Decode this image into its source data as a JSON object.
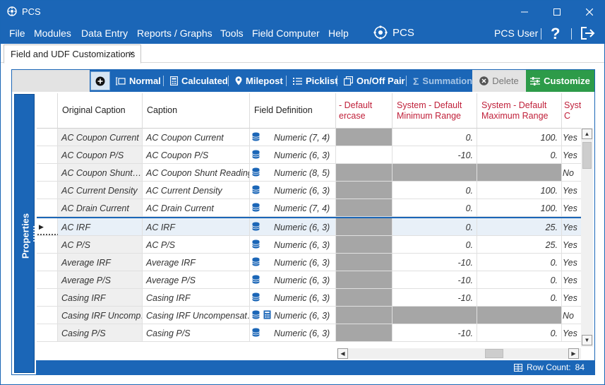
{
  "window": {
    "title": "PCS"
  },
  "menu": {
    "items": [
      "File",
      "Modules",
      "Data Entry",
      "Reports / Graphs",
      "Tools",
      "Field Computer",
      "Help"
    ],
    "brand": "PCS",
    "user": "PCS User",
    "help": "?"
  },
  "tab": {
    "label": "Field and UDF Customizations",
    "close": "×"
  },
  "toolbar": {
    "normal": "Normal",
    "calculated": "Calculated",
    "milepost": "Milepost",
    "picklist": "Picklist",
    "onoff": "On/Off Pair",
    "summation": "Summation",
    "delete": "Delete",
    "customize": "Customize"
  },
  "properties_label": "Properties",
  "grid": {
    "headers": {
      "original": "Original Caption",
      "caption": "Caption",
      "definition": "Field Definition",
      "default_pct": "- Default ercase",
      "min_range": "System - Default Minimum Range",
      "max_range": "System - Default Maximum Range",
      "sys_c": "Syste C"
    },
    "rows": [
      {
        "orig": "AC Coupon Current",
        "caption": "AC Coupon Current",
        "def": "Numeric (7, 4)",
        "calc": false,
        "pct_gray": true,
        "min": "0.",
        "max": "100.",
        "yn": "Yes"
      },
      {
        "orig": "AC Coupon P/S",
        "caption": "AC Coupon P/S",
        "def": "Numeric (6, 3)",
        "calc": false,
        "pct_gray": false,
        "min": "-10.",
        "max": "0.",
        "yn": "Yes"
      },
      {
        "orig": "AC Coupon Shunt…",
        "caption": "AC Coupon Shunt Reading",
        "def": "Numeric (8, 5)",
        "calc": false,
        "pct_gray": true,
        "min": "",
        "max": "",
        "yn": "No",
        "range_gray": true
      },
      {
        "orig": "AC Current Density",
        "caption": "AC Current Density",
        "def": "Numeric (6, 3)",
        "calc": false,
        "pct_gray": true,
        "min": "0.",
        "max": "100.",
        "yn": "Yes"
      },
      {
        "orig": "AC Drain Current",
        "caption": "AC Drain Current",
        "def": "Numeric (7, 4)",
        "calc": false,
        "pct_gray": true,
        "min": "0.",
        "max": "100.",
        "yn": "Yes"
      },
      {
        "orig": "AC IRF",
        "caption": "AC IRF",
        "def": "Numeric (6, 3)",
        "calc": false,
        "pct_gray": true,
        "min": "0.",
        "max": "25.",
        "yn": "Yes",
        "selected": true
      },
      {
        "orig": "AC P/S",
        "caption": "AC P/S",
        "def": "Numeric (6, 3)",
        "calc": false,
        "pct_gray": true,
        "min": "0.",
        "max": "25.",
        "yn": "Yes"
      },
      {
        "orig": "Average IRF",
        "caption": "Average IRF",
        "def": "Numeric (6, 3)",
        "calc": false,
        "pct_gray": true,
        "min": "-10.",
        "max": "0.",
        "yn": "Yes"
      },
      {
        "orig": "Average P/S",
        "caption": "Average P/S",
        "def": "Numeric (6, 3)",
        "calc": false,
        "pct_gray": true,
        "min": "-10.",
        "max": "0.",
        "yn": "Yes"
      },
      {
        "orig": "Casing IRF",
        "caption": "Casing IRF",
        "def": "Numeric (6, 3)",
        "calc": false,
        "pct_gray": true,
        "min": "-10.",
        "max": "0.",
        "yn": "Yes"
      },
      {
        "orig": "Casing IRF Uncomp…",
        "caption": "Casing IRF Uncompensat…",
        "def": "Numeric (6, 3)",
        "calc": true,
        "pct_gray": true,
        "min": "",
        "max": "",
        "yn": "No",
        "range_gray": true
      },
      {
        "orig": "Casing P/S",
        "caption": "Casing P/S",
        "def": "Numeric (6, 3)",
        "calc": false,
        "pct_gray": true,
        "min": "-10.",
        "max": "0.",
        "yn": "Yes"
      }
    ]
  },
  "status": {
    "row_count_label": "Row Count:",
    "row_count": "84"
  },
  "colors": {
    "accent": "#1b66b7",
    "customize": "#2d9b49",
    "header_red": "#c0203a",
    "disabled_cell": "#a6a6a6"
  }
}
